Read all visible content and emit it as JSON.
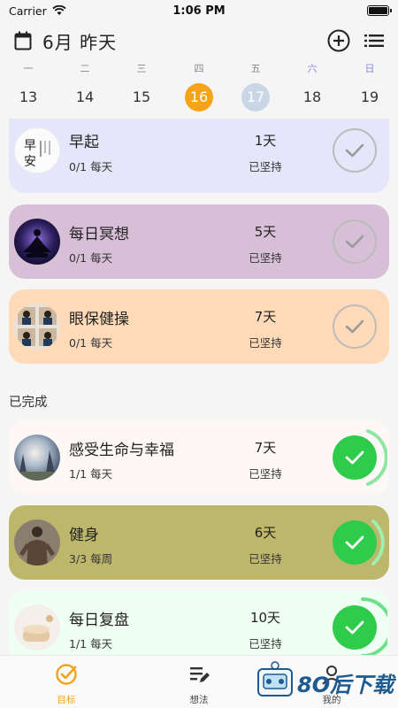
{
  "status_bar": {
    "carrier": "Carrier",
    "time": "1:06 PM"
  },
  "header": {
    "title": "6月 昨天",
    "calendar_icon": "calendar-icon",
    "add_icon": "add-circle-icon",
    "list_icon": "list-icon"
  },
  "week": {
    "days": [
      {
        "weekday": "一",
        "date": "13"
      },
      {
        "weekday": "二",
        "date": "14"
      },
      {
        "weekday": "三",
        "date": "15"
      },
      {
        "weekday": "四",
        "date": "16"
      },
      {
        "weekday": "五",
        "date": "17"
      },
      {
        "weekday": "六",
        "date": "18"
      },
      {
        "weekday": "日",
        "date": "19"
      }
    ],
    "today_color": "#f7a318",
    "selected_color": "#c8d6e6"
  },
  "habits_pending": [
    {
      "name": "早起",
      "progress": "0/1 每天",
      "days": "1天",
      "days_label": "已坚持",
      "bg": "#e6e6fa",
      "avatar_text": "早安"
    },
    {
      "name": "每日冥想",
      "progress": "0/1 每天",
      "days": "5天",
      "days_label": "已坚持",
      "bg": "#d8bfd8"
    },
    {
      "name": "眼保健操",
      "progress": "0/1 每天",
      "days": "7天",
      "days_label": "已坚持",
      "bg": "#fedab8"
    }
  ],
  "completed_section": {
    "title": "已完成"
  },
  "habits_done": [
    {
      "name": "感受生命与幸福",
      "progress": "1/1 每天",
      "days": "7天",
      "days_label": "已坚持",
      "bg": "#fdf8f6"
    },
    {
      "name": "健身",
      "progress": "3/3 每周",
      "days": "6天",
      "days_label": "已坚持",
      "bg": "#bdb76b"
    },
    {
      "name": "每日复盘",
      "progress": "1/1 每天",
      "days": "10天",
      "days_label": "已坚持",
      "bg": "#f0fff4"
    }
  ],
  "done_color": "#2fcb4b",
  "tabbar": {
    "tabs": [
      {
        "label": "目标",
        "icon": "target-check-icon"
      },
      {
        "label": "想法",
        "icon": "note-edit-icon"
      },
      {
        "label": "我的",
        "icon": "user-icon"
      }
    ],
    "active_color": "#f2a318"
  },
  "watermark": {
    "text": "8O后下载"
  }
}
